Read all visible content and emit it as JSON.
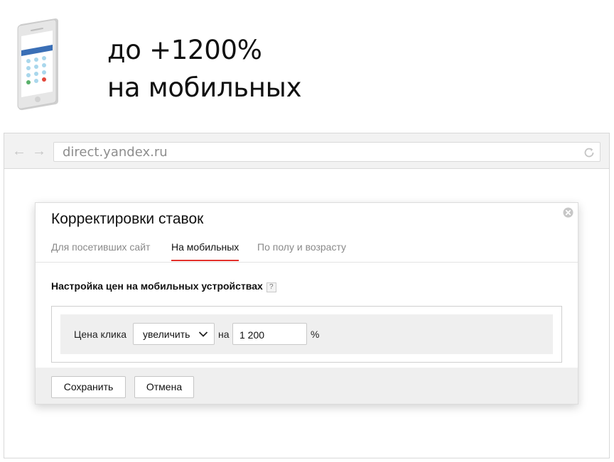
{
  "hero": {
    "line1": "до +1200%",
    "line2": "на мобильных",
    "icon": "smartphone-icon"
  },
  "browser": {
    "url": "direct.yandex.ru",
    "back_icon": "←",
    "forward_icon": "→"
  },
  "dialog": {
    "title": "Корректировки ставок",
    "tabs": [
      {
        "label": "Для посетивших сайт",
        "active": false
      },
      {
        "label": "На мобильных",
        "active": true
      },
      {
        "label": "По полу и возрасту",
        "active": false
      }
    ],
    "section_heading": "Настройка цен на мобильных устройствах",
    "help_icon_glyph": "?",
    "row": {
      "label": "Цена клика",
      "select_value": "увеличить",
      "preposition": "на",
      "input_value": "1 200",
      "unit": "%"
    },
    "buttons": {
      "save": "Сохранить",
      "cancel": "Отмена"
    }
  },
  "colors": {
    "accent_underline": "#e3302b",
    "phone_header": "#3a6fb6",
    "phone_dots": "#a9d7ec",
    "phone_red_dot": "#e2473b",
    "phone_green_dot": "#58b06a"
  }
}
